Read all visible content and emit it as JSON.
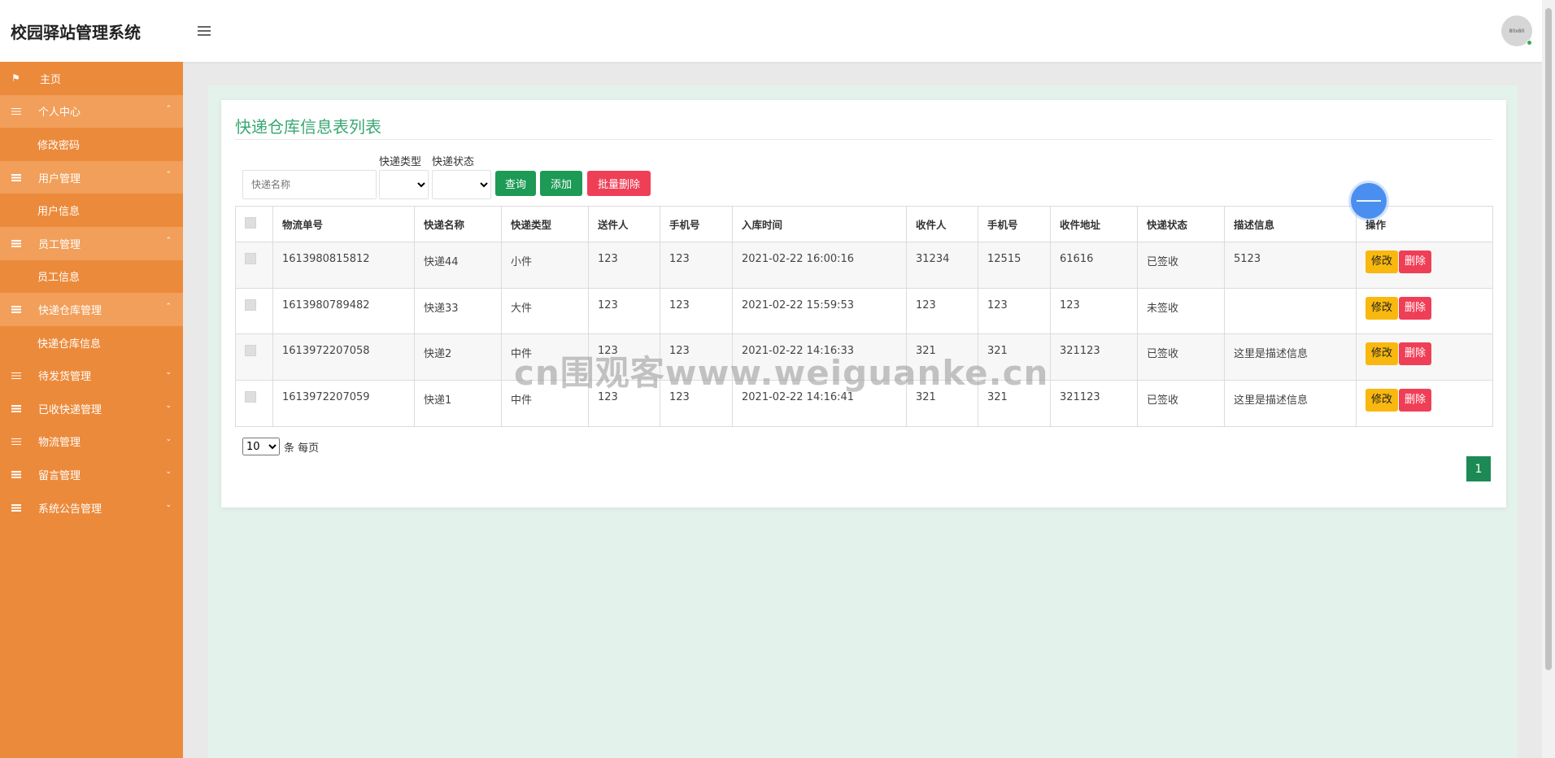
{
  "app": {
    "title": "校园驿站管理系统",
    "avatar_text": "80x80"
  },
  "sidebar": {
    "items": [
      {
        "label": "主页",
        "type": "top",
        "icon": "flag-icon"
      },
      {
        "label": "个人中心",
        "type": "group",
        "icon": "list-icon"
      },
      {
        "label": "修改密码",
        "type": "child"
      },
      {
        "label": "用户管理",
        "type": "group",
        "icon": "list-icon"
      },
      {
        "label": "用户信息",
        "type": "child"
      },
      {
        "label": "员工管理",
        "type": "group",
        "icon": "list-icon"
      },
      {
        "label": "员工信息",
        "type": "child"
      },
      {
        "label": "快递仓库管理",
        "type": "group",
        "icon": "list-icon"
      },
      {
        "label": "快递仓库信息",
        "type": "child"
      },
      {
        "label": "待发货管理",
        "type": "collapsed",
        "icon": "list-icon"
      },
      {
        "label": "已收快递管理",
        "type": "collapsed",
        "icon": "list-icon"
      },
      {
        "label": "物流管理",
        "type": "collapsed",
        "icon": "list-icon"
      },
      {
        "label": "留言管理",
        "type": "collapsed",
        "icon": "list-icon"
      },
      {
        "label": "系统公告管理",
        "type": "collapsed",
        "icon": "list-icon"
      }
    ]
  },
  "main": {
    "title": "快递仓库信息表列表",
    "search": {
      "placeholder": "快递名称",
      "value": ""
    },
    "filters": {
      "type_label": "快递类型",
      "status_label": "快递状态",
      "type_value": "",
      "status_value": ""
    },
    "buttons": {
      "query": "查询",
      "add": "添加",
      "batch_delete": "批量删除"
    },
    "table": {
      "columns": [
        "物流单号",
        "快递名称",
        "快递类型",
        "送件人",
        "手机号",
        "入库时间",
        "收件人",
        "手机号",
        "收件地址",
        "快递状态",
        "描述信息",
        "操作"
      ],
      "rows": [
        [
          "1613980815812",
          "快递44",
          "小件",
          "123",
          "123",
          "2021-02-22 16:00:16",
          "31234",
          "12515",
          "61616",
          "已签收",
          "5123"
        ],
        [
          "1613980789482",
          "快递33",
          "大件",
          "123",
          "123",
          "2021-02-22 15:59:53",
          "123",
          "123",
          "123",
          "未签收",
          ""
        ],
        [
          "1613972207058",
          "快递2",
          "中件",
          "123",
          "123",
          "2021-02-22 14:16:33",
          "321",
          "321",
          "321123",
          "已签收",
          "这里是描述信息"
        ],
        [
          "1613972207059",
          "快递1",
          "中件",
          "123",
          "123",
          "2021-02-22 14:16:41",
          "321",
          "321",
          "321123",
          "已签收",
          "这里是描述信息"
        ]
      ],
      "edit_label": "修改",
      "delete_label": "删除"
    },
    "pagination": {
      "page_size": "10",
      "page_size_label": "条 每页",
      "current_page": "1"
    }
  },
  "watermark": "cn围观客www.weiguanke.cn",
  "colors": {
    "sidebar": "#ec8a3b",
    "accent_green": "#1d9a55",
    "danger": "#ef3f57",
    "warning": "#f9b80f"
  }
}
